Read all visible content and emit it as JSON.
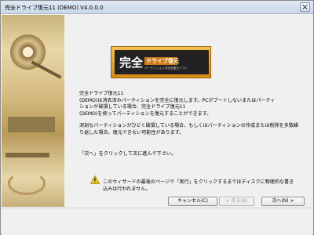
{
  "window": {
    "title": "完全ドライブ復元11 (DEMO) V4.0.0.0"
  },
  "banner": {
    "main_text": "完全",
    "badge_text": "ドライブ復元",
    "sub_text": "パーティションの完全復元ソフト"
  },
  "content": {
    "description_lines": [
      "完全ドライブ復元11",
      "(DEMO)は消去済みパーティションを完全に復元します。PCがブートしないまたはパーティ",
      "ションが破損している場合、完全ドライブ復元11",
      "(DEMO)を使ってパーティションを復元することができます。"
    ],
    "damage_lines": [
      "深刻なパーティションがひどく破損している場合、もしくはパーティションの作成または削除を多数繰",
      "り返した場合、復元できない可能性があります。"
    ],
    "next_note": "「次へ」をクリックして次に進んで下さい。",
    "warning_lines": [
      "このウィザードの最後のページで「実行」をクリックするまではディスクに物理的な書き",
      "込みは行われません。"
    ]
  },
  "buttons": {
    "cancel": "キャンセル(C)",
    "back": "< 戻る(B)",
    "next": "次へ(N) >"
  },
  "colors": {
    "title_bar": "#dfe9f5",
    "banner_gold": "#f4c24d",
    "banner_dark": "#222222",
    "warning_yellow": "#f7d11b"
  }
}
